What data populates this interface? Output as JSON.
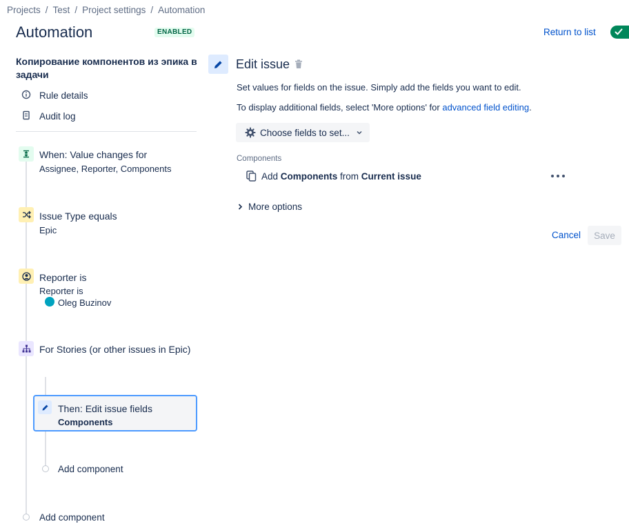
{
  "breadcrumb": [
    "Projects",
    "Test",
    "Project settings",
    "Automation"
  ],
  "breadcrumb_separator": "/",
  "header": {
    "title": "Automation",
    "status_badge": "ENABLED",
    "return_link": "Return to list",
    "toggle_state": "on"
  },
  "sidebar": {
    "rule_name": "Копирование компонентов из эпика в задачи",
    "links": [
      {
        "label": "Rule details",
        "icon": "info-icon"
      },
      {
        "label": "Audit log",
        "icon": "document-icon"
      }
    ],
    "steps": {
      "trigger": {
        "title": "When: Value changes for",
        "sub": "Assignee, Reporter, Components",
        "icon": "trigger-icon"
      },
      "condition1": {
        "title": "Issue Type equals",
        "sub": "Epic",
        "icon": "shuffle-icon"
      },
      "condition2": {
        "title": "Reporter is",
        "sub": "Reporter is",
        "user": "Oleg Buzinov",
        "icon": "user-icon"
      },
      "branch": {
        "title": "For Stories (or other issues in Epic)",
        "icon": "branch-icon"
      },
      "action": {
        "title": "Then: Edit issue fields",
        "sub": "Components",
        "icon": "pencil-icon"
      }
    },
    "add_component_inner": "Add component",
    "add_component_outer": "Add component"
  },
  "panel": {
    "title": "Edit issue",
    "desc1": "Set values for fields on the issue. Simply add the fields you want to edit.",
    "desc2_prefix": "To display additional fields, select 'More options' for ",
    "desc2_link": "advanced field editing",
    "desc2_suffix": ".",
    "choose_button": "Choose fields to set...",
    "field_label": "Components",
    "field_row": {
      "prefix": "Add ",
      "field": "Components",
      "middle": " from ",
      "source": "Current issue"
    },
    "more_options": "More options",
    "cancel": "Cancel",
    "save": "Save"
  },
  "colors": {
    "accent": "#0052cc",
    "enabled_text": "#006644",
    "enabled_bg": "#e3fcef",
    "toggle": "#00875a",
    "selected_border": "#4c9aff"
  }
}
